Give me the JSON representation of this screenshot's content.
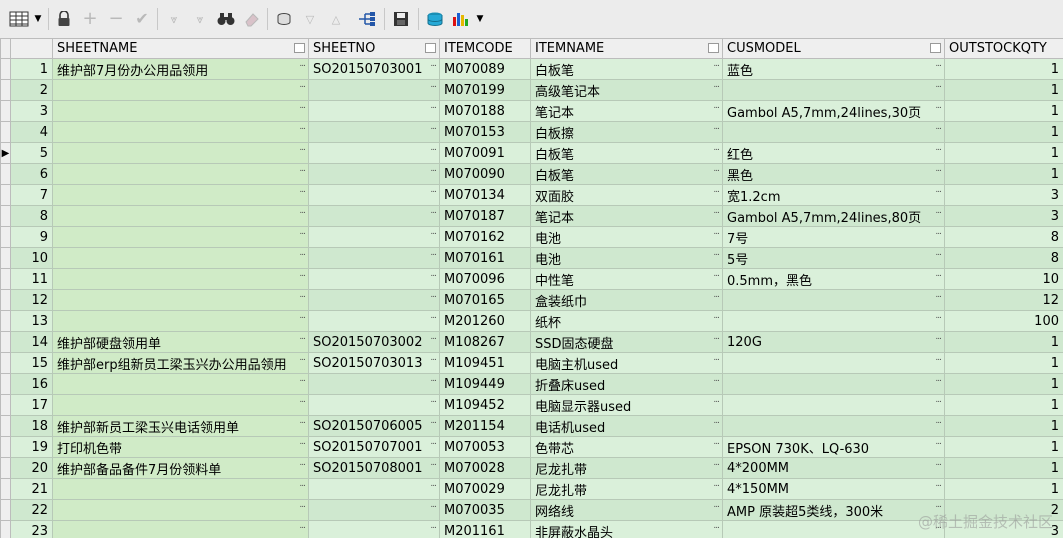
{
  "toolbar": {
    "icons": [
      "grid-icon",
      "dropdown-arrow-icon",
      "lock-icon",
      "plus-icon",
      "minus-icon",
      "check-icon",
      "filter-down-icon",
      "filter-clear-icon",
      "binoculars-icon",
      "eraser-icon",
      "import-icon",
      "sort-desc-icon",
      "sort-asc-icon",
      "tree-icon",
      "save-icon",
      "database-icon",
      "chart-icon",
      "chart-dropdown-icon"
    ]
  },
  "grid": {
    "columns": [
      "SHEETNAME",
      "SHEETNO",
      "ITEMCODE",
      "ITEMNAME",
      "CUSMODEL",
      "OUTSTOCKQTY"
    ],
    "current_row": 5,
    "rows": [
      {
        "num": "1",
        "sheetname": "维护部7月份办公用品领用",
        "sheetno": "SO20150703001",
        "itemcode": "M070089",
        "itemname": "白板笔",
        "cusmodel": "蓝色",
        "qty": "1"
      },
      {
        "num": "2",
        "sheetname": "",
        "sheetno": "",
        "itemcode": "M070199",
        "itemname": "高级笔记本",
        "cusmodel": "",
        "qty": "1"
      },
      {
        "num": "3",
        "sheetname": "",
        "sheetno": "",
        "itemcode": "M070188",
        "itemname": "笔记本",
        "cusmodel": "Gambol  A5,7mm,24lines,30页",
        "qty": "1"
      },
      {
        "num": "4",
        "sheetname": "",
        "sheetno": "",
        "itemcode": "M070153",
        "itemname": "白板擦",
        "cusmodel": "",
        "qty": "1"
      },
      {
        "num": "5",
        "sheetname": "",
        "sheetno": "",
        "itemcode": "M070091",
        "itemname": "白板笔",
        "cusmodel": "红色",
        "qty": "1"
      },
      {
        "num": "6",
        "sheetname": "",
        "sheetno": "",
        "itemcode": "M070090",
        "itemname": "白板笔",
        "cusmodel": "黑色",
        "qty": "1"
      },
      {
        "num": "7",
        "sheetname": "",
        "sheetno": "",
        "itemcode": "M070134",
        "itemname": "双面胶",
        "cusmodel": "宽1.2cm",
        "qty": "3"
      },
      {
        "num": "8",
        "sheetname": "",
        "sheetno": "",
        "itemcode": "M070187",
        "itemname": "笔记本",
        "cusmodel": "Gambol  A5,7mm,24lines,80页",
        "qty": "3"
      },
      {
        "num": "9",
        "sheetname": "",
        "sheetno": "",
        "itemcode": "M070162",
        "itemname": "电池",
        "cusmodel": "7号",
        "qty": "8"
      },
      {
        "num": "10",
        "sheetname": "",
        "sheetno": "",
        "itemcode": "M070161",
        "itemname": "电池",
        "cusmodel": "5号",
        "qty": "8"
      },
      {
        "num": "11",
        "sheetname": "",
        "sheetno": "",
        "itemcode": "M070096",
        "itemname": "中性笔",
        "cusmodel": "0.5mm，黑色",
        "qty": "10"
      },
      {
        "num": "12",
        "sheetname": "",
        "sheetno": "",
        "itemcode": "M070165",
        "itemname": "盒装纸巾",
        "cusmodel": "",
        "qty": "12"
      },
      {
        "num": "13",
        "sheetname": "",
        "sheetno": "",
        "itemcode": "M201260",
        "itemname": "纸杯",
        "cusmodel": "",
        "qty": "100"
      },
      {
        "num": "14",
        "sheetname": "维护部硬盘领用单",
        "sheetno": "SO20150703002",
        "itemcode": "M108267",
        "itemname": "SSD固态硬盘",
        "cusmodel": "120G",
        "qty": "1"
      },
      {
        "num": "15",
        "sheetname": "维护部erp组新员工梁玉兴办公用品领用",
        "sheetno": "SO20150703013",
        "itemcode": "M109451",
        "itemname": "电脑主机used",
        "cusmodel": "",
        "qty": "1"
      },
      {
        "num": "16",
        "sheetname": "",
        "sheetno": "",
        "itemcode": "M109449",
        "itemname": "折叠床used",
        "cusmodel": "",
        "qty": "1"
      },
      {
        "num": "17",
        "sheetname": "",
        "sheetno": "",
        "itemcode": "M109452",
        "itemname": "电脑显示器used",
        "cusmodel": "",
        "qty": "1"
      },
      {
        "num": "18",
        "sheetname": "维护部新员工梁玉兴电话领用单",
        "sheetno": "SO20150706005",
        "itemcode": "M201154",
        "itemname": "电话机used",
        "cusmodel": "",
        "qty": "1"
      },
      {
        "num": "19",
        "sheetname": "打印机色带",
        "sheetno": "SO20150707001",
        "itemcode": "M070053",
        "itemname": "色带芯",
        "cusmodel": "EPSON   730K、LQ-630",
        "qty": "1"
      },
      {
        "num": "20",
        "sheetname": "维护部备品备件7月份领料单",
        "sheetno": "SO20150708001",
        "itemcode": "M070028",
        "itemname": "尼龙扎带",
        "cusmodel": "4*200MM",
        "qty": "1"
      },
      {
        "num": "21",
        "sheetname": "",
        "sheetno": "",
        "itemcode": "M070029",
        "itemname": "尼龙扎带",
        "cusmodel": "4*150MM",
        "qty": "1"
      },
      {
        "num": "22",
        "sheetname": "",
        "sheetno": "",
        "itemcode": "M070035",
        "itemname": "网络线",
        "cusmodel": "AMP  原装超5类线，300米",
        "qty": "2"
      },
      {
        "num": "23",
        "sheetname": "",
        "sheetno": "",
        "itemcode": "M201161",
        "itemname": "非屏蔽水晶头",
        "cusmodel": "",
        "qty": "3"
      }
    ]
  },
  "watermark": "@稀土掘金技术社区"
}
